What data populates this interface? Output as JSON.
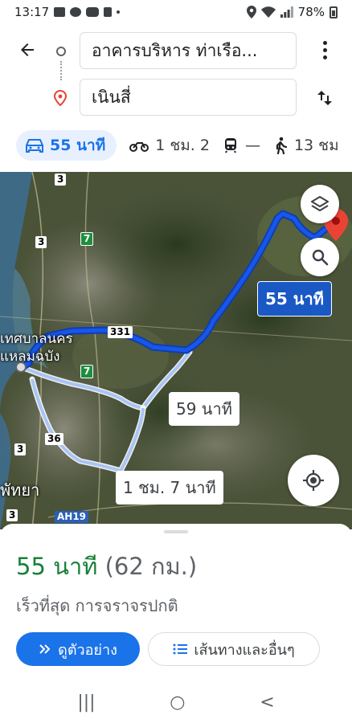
{
  "status_bar": {
    "time": "13:17",
    "battery": "78%",
    "icons": [
      "gallery-icon",
      "chat-icon",
      "line-icon",
      "tiktok-icon",
      "location-icon",
      "wifi-icon",
      "signal-icon",
      "battery-icon"
    ]
  },
  "route": {
    "origin": "อาคารบริหาร ท่าเรือ...",
    "destination": "เนินสี่"
  },
  "modes": [
    {
      "icon": "car-icon",
      "label": "55 นาที",
      "active": true
    },
    {
      "icon": "motorcycle-icon",
      "label": "1 ชม. 2",
      "active": false
    },
    {
      "icon": "transit-icon",
      "label": "—",
      "active": false
    },
    {
      "icon": "walk-icon",
      "label": "13 ชม",
      "active": false
    }
  ],
  "map": {
    "primary_time": "55 นาที",
    "alt_time_1": "59 นาที",
    "alt_time_2": "1 ชม. 7 นาที",
    "places": [
      "เทศบาลนคร",
      "แหลมฉบัง",
      "พัทยา"
    ],
    "road_shields": {
      "r3_top": "3",
      "r3_left": "3",
      "r7_top": "7",
      "r7_mid": "7",
      "r331": "331",
      "r36": "36",
      "r3_low": "3",
      "r3_bottom": "3",
      "ah19": "AH19"
    },
    "colors": {
      "primary_route": "#1a56e8",
      "alt_route": "#a9c4f5",
      "destination_pin": "#ea4335"
    }
  },
  "summary": {
    "duration": "55 นาที",
    "distance": "(62 กม.)",
    "subtext": "เร็วที่สุด การจราจรปกติ"
  },
  "actions": {
    "preview": "ดูตัวอย่าง",
    "steps": "เส้นทางและอื่นๆ"
  },
  "nav": {
    "recents": "|||",
    "home": "○",
    "back": "<"
  }
}
